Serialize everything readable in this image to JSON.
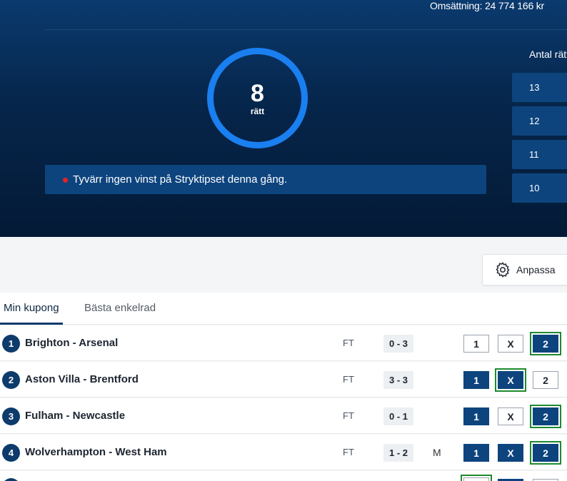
{
  "hero": {
    "turnover": "Omsättning: 24 774 166 kr",
    "score_number": "8",
    "score_label": "rätt",
    "message": "Tyvärr ingen vinst på Stryktipset denna gång.",
    "antal_title": "Antal rätt",
    "antal_rows": [
      "13",
      "12",
      "11",
      "10"
    ]
  },
  "toolbar": {
    "anpassa_label": "Anpassa"
  },
  "tabs": [
    {
      "label": "Min kupong",
      "active": true
    },
    {
      "label": "Bästa enkelrad",
      "active": false
    }
  ],
  "matches": [
    {
      "index": "1",
      "teams": "Brighton - Arsenal",
      "status": "FT",
      "score": "0 - 3",
      "flag": "",
      "options": [
        "1",
        "X",
        "2"
      ],
      "selected": [
        false,
        false,
        true
      ],
      "correct": "2"
    },
    {
      "index": "2",
      "teams": "Aston Villa - Brentford",
      "status": "FT",
      "score": "3 - 3",
      "flag": "",
      "options": [
        "1",
        "X",
        "2"
      ],
      "selected": [
        true,
        true,
        false
      ],
      "correct": "X"
    },
    {
      "index": "3",
      "teams": "Fulham - Newcastle",
      "status": "FT",
      "score": "0 - 1",
      "flag": "",
      "options": [
        "1",
        "X",
        "2"
      ],
      "selected": [
        true,
        false,
        true
      ],
      "correct": "2"
    },
    {
      "index": "4",
      "teams": "Wolverhampton - West Ham",
      "status": "FT",
      "score": "1 - 2",
      "flag": "M",
      "options": [
        "1",
        "X",
        "2"
      ],
      "selected": [
        true,
        true,
        true
      ],
      "correct": "2"
    }
  ],
  "colors": {
    "hero_top": "#0a3a6e",
    "hero_bottom": "#041a36",
    "ring": "#1a7ff0",
    "selected": "#0d447e",
    "correct_outline": "#1e8a2f",
    "error_dot": "#e32323"
  }
}
